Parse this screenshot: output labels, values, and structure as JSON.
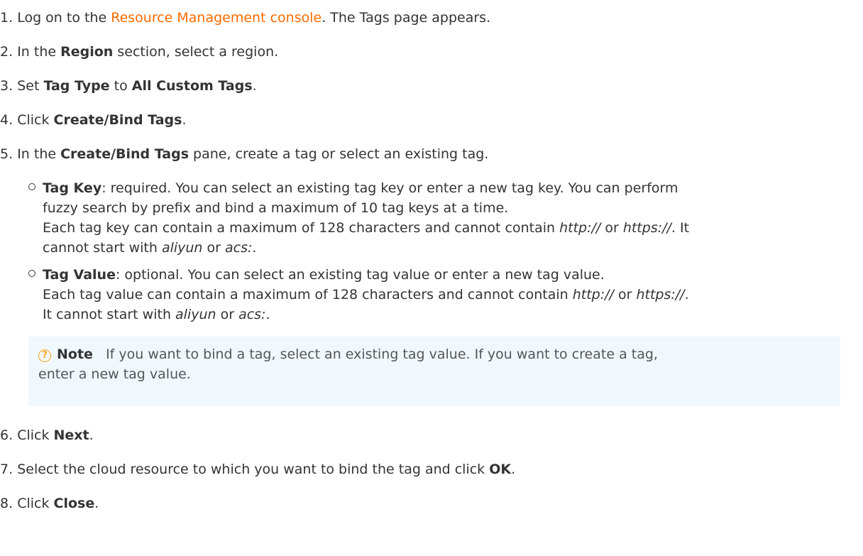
{
  "steps": [
    {
      "num": "1.",
      "pre": "Log on to the ",
      "link": "Resource Management console",
      "post": ". The Tags page appears."
    },
    {
      "num": "2.",
      "pre": "In the ",
      "b1": "Region",
      "post": " section, select a region."
    },
    {
      "num": "3.",
      "pre": "Set ",
      "b1": "Tag Type",
      "mid": " to ",
      "b2": "All Custom Tags",
      "post": "."
    },
    {
      "num": "4.",
      "pre": "Click ",
      "b1": "Create/Bind Tags",
      "post": "."
    },
    {
      "num": "5.",
      "pre": "In the ",
      "b1": "Create/Bind Tags",
      "post": " pane, create a tag or select an existing tag."
    },
    {
      "num": "6.",
      "pre": "Click ",
      "b1": "Next",
      "post": "."
    },
    {
      "num": "7.",
      "pre": "Select the cloud resource to which you want to bind the tag and click ",
      "b1": "OK",
      "post": "."
    },
    {
      "num": "8.",
      "pre": "Click ",
      "b1": "Close",
      "post": "."
    }
  ],
  "tag_key": {
    "label": "Tag Key",
    "line1": ": required. You can select an existing tag key or enter a new tag key. You can perform",
    "line2": "fuzzy search by prefix and bind a maximum of 10 tag keys at a time.",
    "line3_pre": "Each tag key can contain a maximum of 128 characters and cannot contain ",
    "http": "http://",
    "or1": " or ",
    "https": "https://",
    "line3_post": ". It",
    "line4_pre": "cannot start with ",
    "aliyun": "aliyun",
    "or2": " or ",
    "acs": "acs:",
    "line4_post": "."
  },
  "tag_value": {
    "label": "Tag Value",
    "line1": ": optional. You can select an existing tag value or enter a new tag value.",
    "line2_pre": "Each tag value can contain a maximum of 128 characters and cannot contain ",
    "http": "http://",
    "or1": " or ",
    "https": "https://",
    "line2_post": ".",
    "line3_pre": "It cannot start with ",
    "aliyun": "aliyun",
    "or2": " or ",
    "acs": "acs:",
    "line3_post": "."
  },
  "note": {
    "icon": "?",
    "title": "Note",
    "line1": "If you want to bind a tag, select an existing tag value. If you want to create a tag,",
    "line2": "enter a new tag value."
  }
}
